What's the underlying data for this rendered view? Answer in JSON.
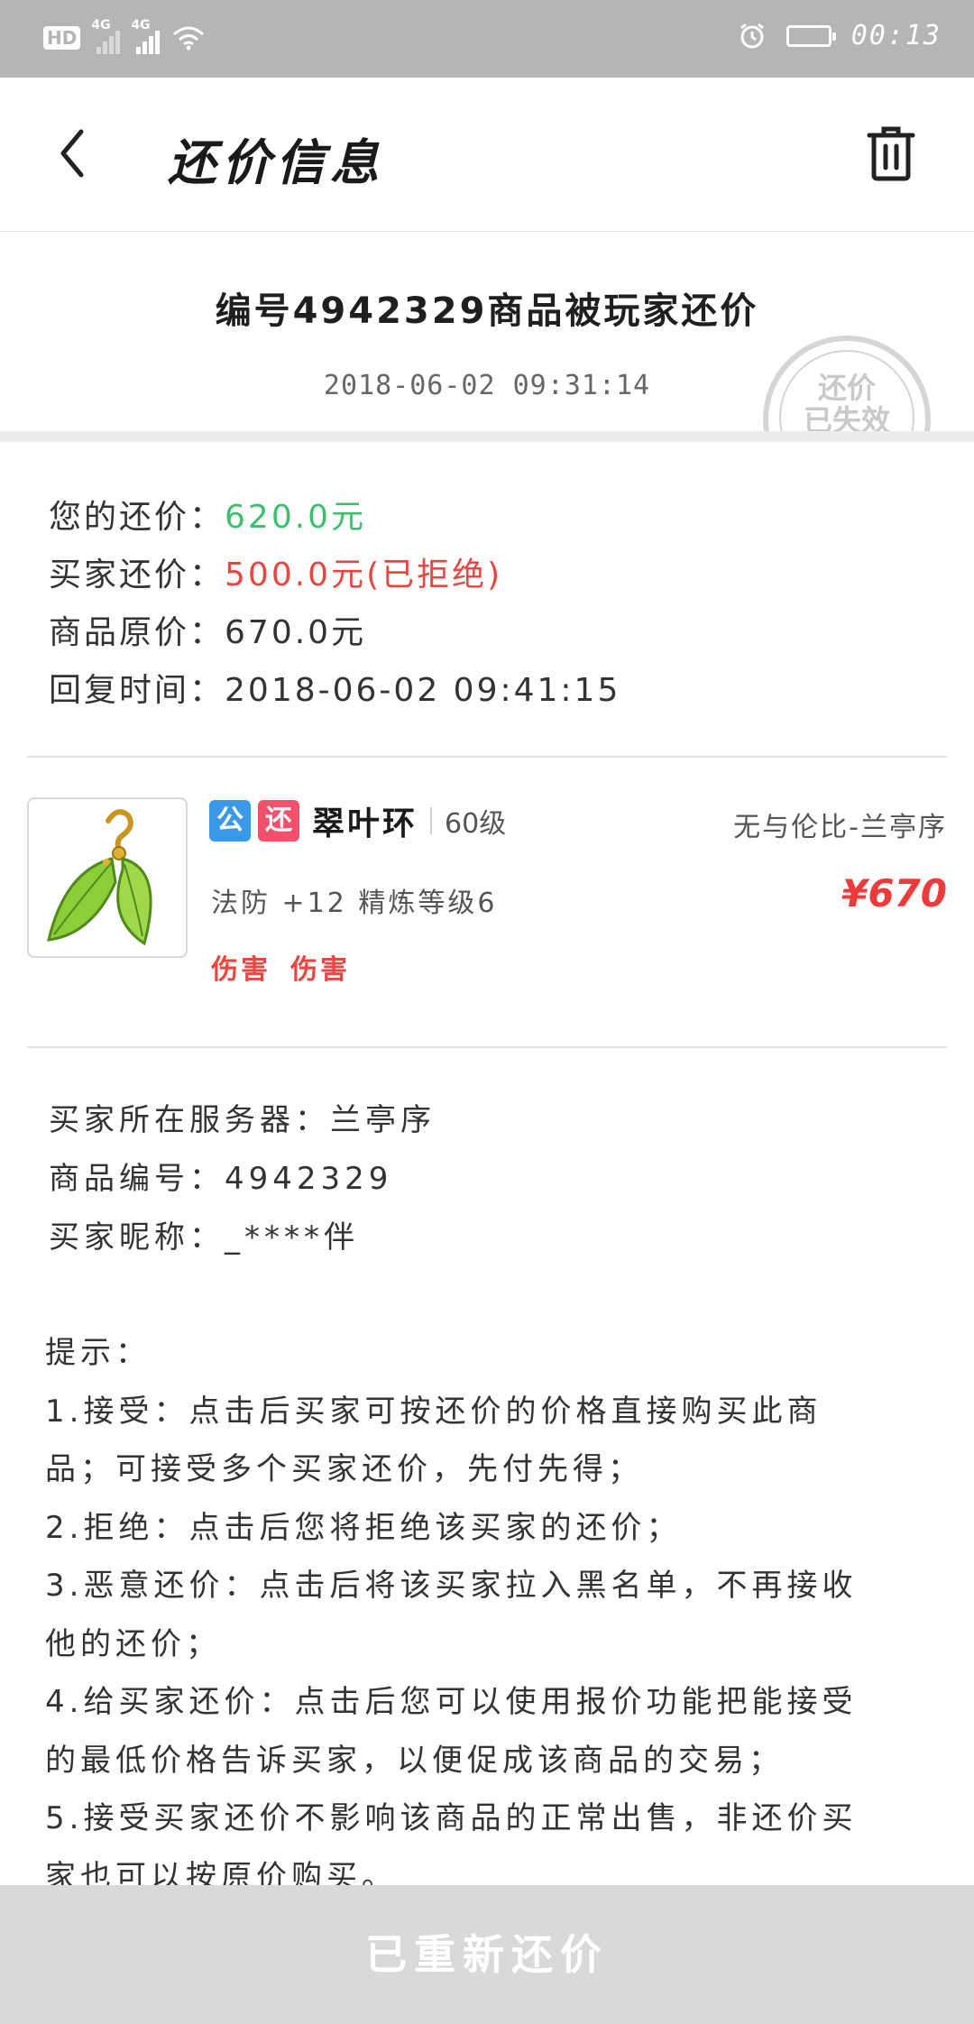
{
  "status_bar": {
    "hd": "HD",
    "net1": "4G",
    "net2": "4G",
    "time": "00:13"
  },
  "header": {
    "title": "还价信息"
  },
  "offer": {
    "title": "编号4942329商品被玩家还价",
    "time": "2018-06-02 09:31:14",
    "stamp_line1": "还价",
    "stamp_line2": "已失效"
  },
  "price_info": {
    "your_offer_label": "您的还价：",
    "your_offer_value": "620.0元",
    "buyer_offer_label": "买家还价：",
    "buyer_offer_value": "500.0元(已拒绝)",
    "original_label": "商品原价：",
    "original_value": "670.0元",
    "reply_label": "回复时间：",
    "reply_value": "2018-06-02 09:41:15"
  },
  "item": {
    "badge_public": "公",
    "badge_return": "还",
    "name": "翠叶环",
    "level": "60级",
    "server": "无与伦比-兰亭序",
    "attr": "法防 +12 精炼等级6",
    "price": "¥670",
    "tags": [
      "伤害",
      "伤害"
    ]
  },
  "buyer_info": {
    "server": "买家所在服务器：兰亭序",
    "product_id": "商品编号：4942329",
    "nickname": "买家昵称：_****伴"
  },
  "tips": {
    "heading": "提示：",
    "lines": [
      "1.接受：点击后买家可按还价的价格直接购买此商",
      "品；可接受多个买家还价，先付先得；",
      "2.拒绝：点击后您将拒绝该买家的还价；",
      "3.恶意还价：点击后将该买家拉入黑名单，不再接收",
      "他的还价；",
      "4.给买家还价：点击后您可以使用报价功能把能接受",
      "的最低价格告诉买家，以便促成该商品的交易；",
      "5.接受买家还价不影响该商品的正常出售，非还价买",
      "家也可以按原价购买。"
    ]
  },
  "bottom_button": {
    "label": "已重新还价"
  },
  "colors": {
    "status_bar": "#b5b5b7",
    "green": "#3fbf6e",
    "red": "#e8463f",
    "badge_public": "#3a98e8",
    "badge_return": "#f2506b",
    "button_bg": "#d9d9d9"
  }
}
